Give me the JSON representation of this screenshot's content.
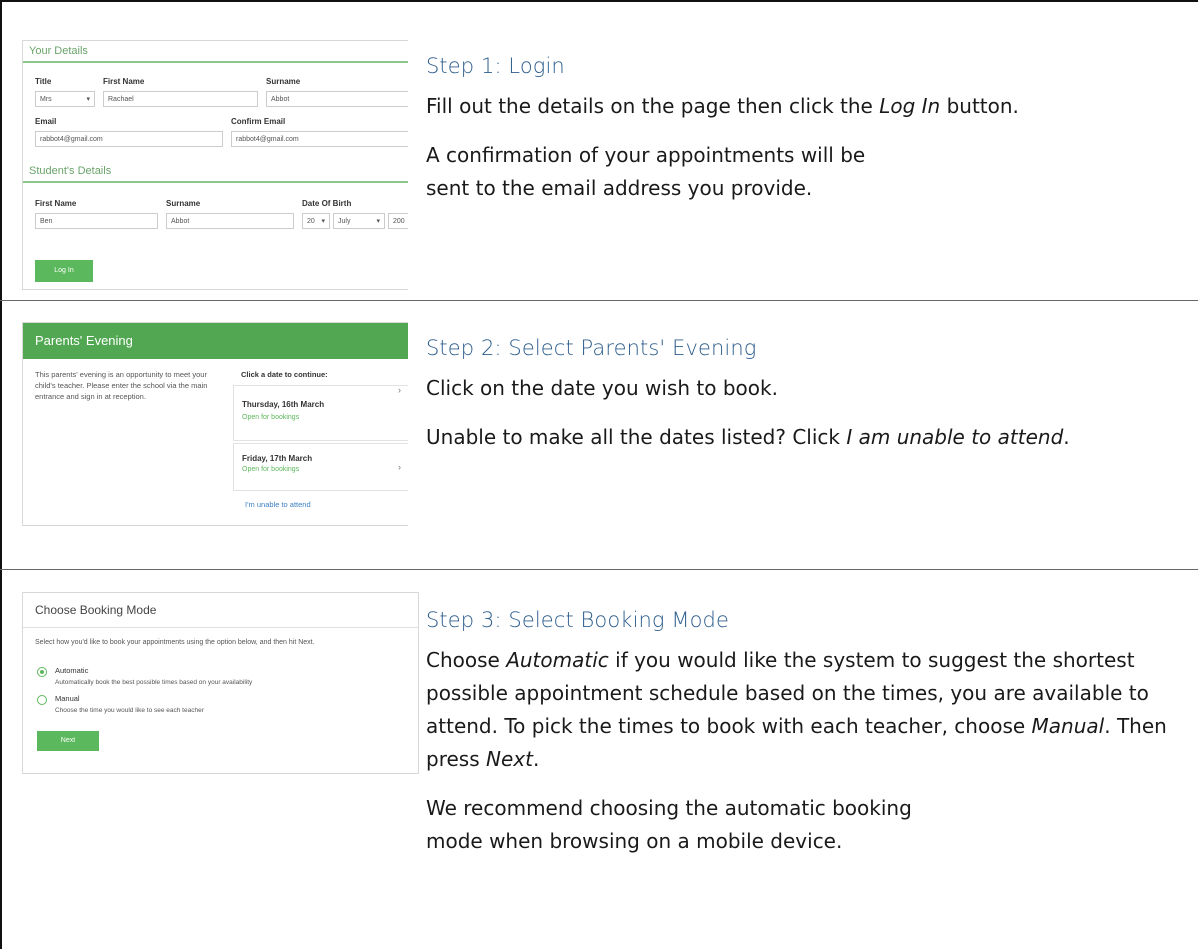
{
  "steps": [
    {
      "title": "Step 1: Login",
      "paragraphs": [
        {
          "pre": "Fill out the details on the page then click the ",
          "em": "Log In",
          "post": " button."
        },
        {
          "pre": "A confirmation of your appointments will be sent to the email address you provide.",
          "em": "",
          "post": ""
        }
      ]
    },
    {
      "title": "Step 2: Select Parents' Evening",
      "paragraphs": [
        {
          "pre": "Click on the date you wish to book.",
          "em": "",
          "post": ""
        },
        {
          "pre": "Unable to make all the dates listed? Click ",
          "em": "I am unable to attend",
          "post": "."
        }
      ]
    },
    {
      "title": "Step 3: Select Booking Mode",
      "paragraph1": {
        "a": "Choose ",
        "b": "Automatic",
        "c": " if you would like the system to suggest the shortest possible appointment schedule based on the times, you are available to attend. To pick the times to book with each teacher, choose ",
        "d": "Manual",
        "e": ". Then press ",
        "f": "Next",
        "g": "."
      },
      "paragraph2": "We recommend choosing the automatic booking mode when browsing on a mobile device."
    }
  ],
  "login_shot": {
    "your_details": "Your Details",
    "title_label": "Title",
    "title_value": "Mrs",
    "first_name_label": "First Name",
    "first_name_value": "Rachael",
    "surname_label": "Surname",
    "surname_value": "Abbot",
    "email_label": "Email",
    "email_value": "rabbot4@gmail.com",
    "confirm_email_label": "Confirm Email",
    "confirm_email_value": "rabbot4@gmail.com",
    "students_details": "Student's Details",
    "s_first_name_label": "First Name",
    "s_first_name_value": "Ben",
    "s_surname_label": "Surname",
    "s_surname_value": "Abbot",
    "dob_label": "Date Of Birth",
    "dob_day": "20",
    "dob_month": "July",
    "dob_year": "200",
    "login_button": "Log In"
  },
  "evening_shot": {
    "header": "Parents' Evening",
    "description": "This parents' evening is an opportunity to meet your child's teacher. Please enter the school via the main entrance and sign in at reception.",
    "click_prompt": "Click a date to continue:",
    "dates": [
      {
        "date": "Thursday, 16th March",
        "status": "Open for bookings"
      },
      {
        "date": "Friday, 17th March",
        "status": "Open for bookings"
      }
    ],
    "unable_link": "I'm unable to attend"
  },
  "booking_shot": {
    "header": "Choose Booking Mode",
    "instruction": "Select how you'd like to book your appointments using the option below, and then hit Next.",
    "automatic_label": "Automatic",
    "automatic_desc": "Automatically book the best possible times based on your availability",
    "manual_label": "Manual",
    "manual_desc": "Choose the time you would like to see each teacher",
    "next_button": "Next"
  }
}
